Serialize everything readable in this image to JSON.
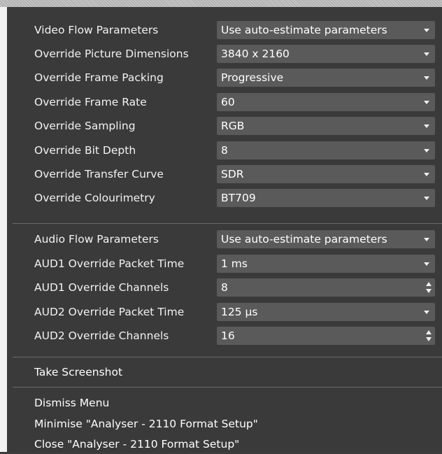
{
  "video": {
    "rows": [
      {
        "label": "Video Flow Parameters",
        "value": "Use auto-estimate parameters",
        "control": "dropdown"
      },
      {
        "label": "Override Picture Dimensions",
        "value": "3840 x 2160",
        "control": "dropdown"
      },
      {
        "label": "Override Frame Packing",
        "value": "Progressive",
        "control": "dropdown"
      },
      {
        "label": "Override Frame Rate",
        "value": "60",
        "control": "dropdown"
      },
      {
        "label": "Override Sampling",
        "value": "RGB",
        "control": "dropdown"
      },
      {
        "label": "Override Bit Depth",
        "value": "8",
        "control": "dropdown"
      },
      {
        "label": "Override Transfer Curve",
        "value": "SDR",
        "control": "dropdown"
      },
      {
        "label": "Override Colourimetry",
        "value": "BT709",
        "control": "dropdown"
      }
    ]
  },
  "audio": {
    "rows": [
      {
        "label": "Audio Flow Parameters",
        "value": "Use auto-estimate parameters",
        "control": "dropdown"
      },
      {
        "label": "AUD1 Override Packet Time",
        "value": "1 ms",
        "control": "dropdown"
      },
      {
        "label": "AUD1 Override Channels",
        "value": "8",
        "control": "spinbox"
      },
      {
        "label": "AUD2 Override Packet Time",
        "value": "125 µs",
        "control": "dropdown"
      },
      {
        "label": "AUD2 Override Channels",
        "value": "16",
        "control": "spinbox"
      }
    ]
  },
  "actions": {
    "screenshot": "Take Screenshot",
    "dismiss": "Dismiss Menu",
    "minimise": "Minimise \"Analyser - 2110 Format Setup\"",
    "close": "Close \"Analyser - 2110 Format Setup\""
  },
  "colors": {
    "menu_background": "#3a3a3a",
    "control_background": "#5a5a5a",
    "separator": "#6a6a6a",
    "text": "#ffffff"
  },
  "icons": {
    "dropdown": "chevron-down-icon",
    "spinbox": "spinner-arrows-icon"
  }
}
